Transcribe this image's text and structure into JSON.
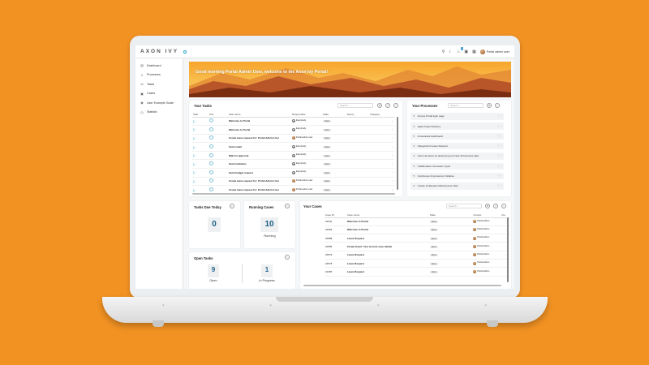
{
  "app": {
    "logo_text": "AXON IVY",
    "user_name": "Portal admin user",
    "notification_count": "3"
  },
  "topbar_icons": [
    "search-icon",
    "moon-icon",
    "bell-icon",
    "case-icon",
    "grid-icon"
  ],
  "sidebar": {
    "items": [
      {
        "label": "Dashboard",
        "icon": "dashboard-icon"
      },
      {
        "label": "Processes",
        "icon": "share-icon"
      },
      {
        "label": "Tasks",
        "icon": "task-icon"
      },
      {
        "label": "Cases",
        "icon": "case-icon"
      },
      {
        "label": "User Example Guide",
        "icon": "map-pin-icon"
      },
      {
        "label": "Statistic",
        "icon": "statistic-icon"
      }
    ]
  },
  "hero": {
    "welcome_text": "Good morning Portal Admin User, welcome to the Axon Ivy Portal!"
  },
  "your_tasks": {
    "title": "Your Tasks",
    "search_placeholder": "Search ...",
    "columns": [
      "Start",
      "Prio",
      "Task name",
      "Responsible",
      "State",
      "Expiry",
      "Category"
    ],
    "rows": [
      {
        "name": "Welcome to Portal",
        "responsible": "Everybody",
        "resp_type": "group",
        "state": "Open"
      },
      {
        "name": "Welcome to Portal",
        "responsible": "Everybody",
        "resp_type": "group",
        "state": "Open"
      },
      {
        "name": "Create leave request for: Portal Admin User",
        "responsible": "Portal admin user",
        "resp_type": "user",
        "state": "Open"
      },
      {
        "name": "Send email",
        "responsible": "Everybody",
        "resp_type": "group",
        "state": "Open"
      },
      {
        "name": "Wait for approval",
        "responsible": "Everybody",
        "resp_type": "group",
        "state": "Open"
      },
      {
        "name": "Send invitation",
        "responsible": "Everybody",
        "resp_type": "group",
        "state": "Open"
      },
      {
        "name": "Send budget request",
        "responsible": "Everybody",
        "resp_type": "group",
        "state": "Open"
      },
      {
        "name": "Create leave request for: Portal Admin User",
        "responsible": "Portal admin user",
        "resp_type": "user",
        "state": "Open"
      },
      {
        "name": "Create leave request for: Portal Admin User",
        "responsible": "Portal admin user",
        "resp_type": "user",
        "state": "Open"
      }
    ]
  },
  "your_processes": {
    "title": "Your Processes",
    "search_placeholder": "Search ...",
    "items": [
      "Access Portal login page",
      "Agile Project Delivery",
      "AI Assistant Dashboard",
      "Categorized Leave Request",
      "Clean all cases by destroying and clear all business data",
      "Collaborative Innovation Cycle",
      "Continuous Improvement Initiative",
      "Create 12 Elevator Maintenance Task"
    ]
  },
  "tasks_due_today": {
    "title": "Tasks Due Today",
    "value": "0"
  },
  "running_cases": {
    "title": "Running Cases",
    "value": "10",
    "label": "Running"
  },
  "open_tasks": {
    "title": "Open Tasks",
    "open_value": "9",
    "open_label": "Open",
    "progress_value": "1",
    "progress_label": "In Progress"
  },
  "your_cases": {
    "title": "Your Cases",
    "search_placeholder": "Search ...",
    "columns": [
      "Case ID",
      "Case name",
      "State",
      "Creator",
      "Cre"
    ],
    "rows": [
      {
        "id": "22641",
        "name": "Welcome to Portal",
        "state": "Open",
        "creator": "Portal admin..."
      },
      {
        "id": "22603",
        "name": "Welcome to Portal",
        "state": "Open",
        "creator": "Portal admin..."
      },
      {
        "id": "22588",
        "name": "Leave Request",
        "state": "Open",
        "creator": "Portal admin..."
      },
      {
        "id": "22586",
        "name": "Create Event: Test custom case details",
        "state": "Open",
        "creator": "Portal admin..."
      },
      {
        "id": "22579",
        "name": "Leave Request",
        "state": "Open",
        "creator": "Portal admin..."
      },
      {
        "id": "22578",
        "name": "Leave Request",
        "state": "Open",
        "creator": "Portal admin..."
      },
      {
        "id": "22455",
        "name": "Leave Request",
        "state": "Open",
        "creator": "Portal admin..."
      }
    ]
  },
  "colors": {
    "background": "#f29223",
    "accent": "#1b5f86",
    "hero_dark": "#8a3a14",
    "hero_light": "#f5b63c"
  }
}
